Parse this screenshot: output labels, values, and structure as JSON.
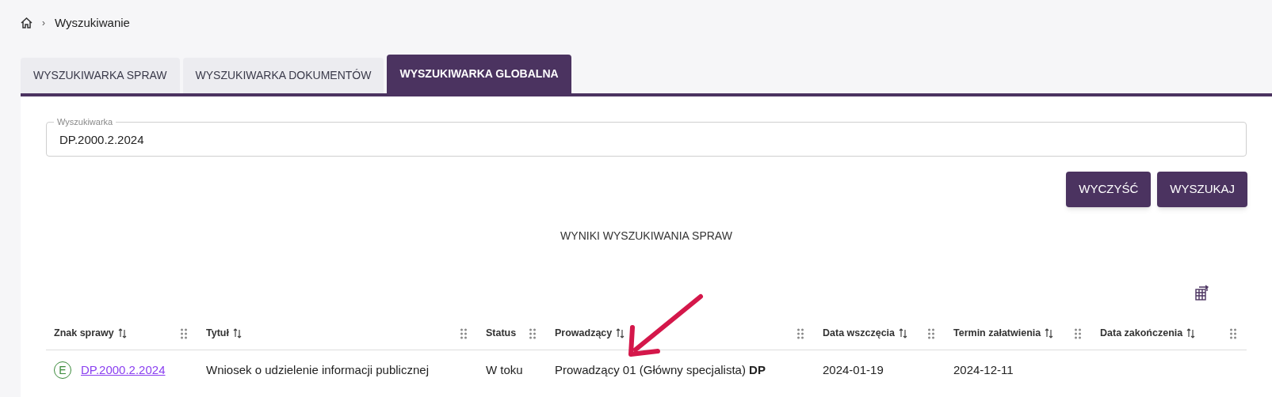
{
  "breadcrumb": {
    "current": "Wyszukiwanie",
    "separator": "›"
  },
  "tabs": [
    {
      "label": "WYSZUKIWARKA SPRAW",
      "selected": false
    },
    {
      "label": "WYSZUKIWARKA DOKUMENTÓW",
      "selected": false
    },
    {
      "label": "WYSZUKIWARKA GLOBALNA",
      "selected": true
    }
  ],
  "search": {
    "label": "Wyszukiwarka",
    "value": "DP.2000.2.2024"
  },
  "buttons": [
    "WYCZYŚĆ",
    "WYSZUKAJ"
  ],
  "results_title": "WYNIKI WYSZUKIWANIA SPRAW",
  "table": {
    "columns": [
      {
        "label": "Znak sprawy",
        "sortable": true
      },
      {
        "label": "Tytuł",
        "sortable": true
      },
      {
        "label": "Status",
        "sortable": false
      },
      {
        "label": "Prowadzący",
        "sortable": true
      },
      {
        "label": "Data wszczęcia",
        "sortable": true
      },
      {
        "label": "Termin załatwienia",
        "sortable": true
      },
      {
        "label": "Data zakończenia",
        "sortable": true
      }
    ],
    "rows": [
      {
        "badge": "E",
        "cells": [
          "DP.2000.2.2024",
          "Wniosek o udzielenie informacji publicznej",
          "W toku",
          "Prowadzący 01 (Główny specjalista) **DP**",
          "2024-01-19",
          "2024-12-11",
          null
        ]
      }
    ]
  }
}
